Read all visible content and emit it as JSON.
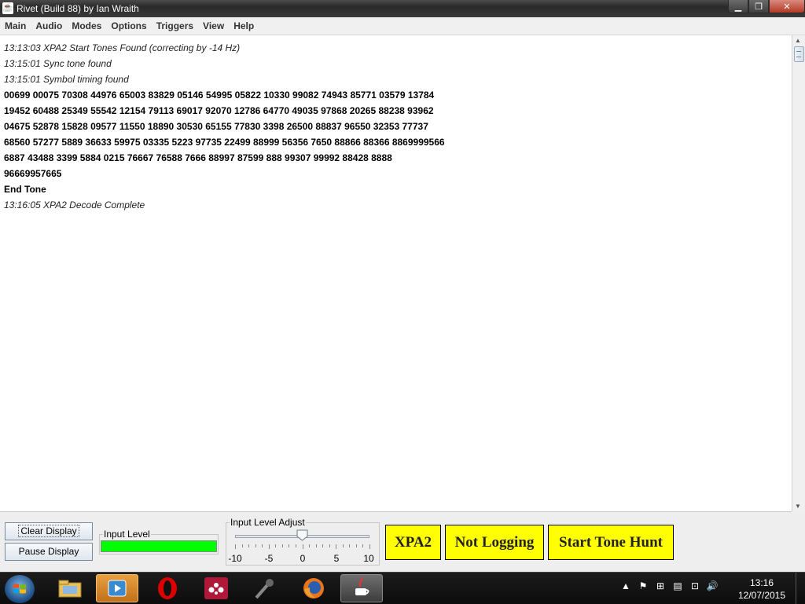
{
  "window": {
    "title": "Rivet (Build 88) by Ian Wraith",
    "icon": "java-cup-icon",
    "controls": [
      "minimize-icon",
      "maximize-icon",
      "close-icon"
    ]
  },
  "menu": {
    "items": [
      "Main",
      "Audio",
      "Modes",
      "Options",
      "Triggers",
      "View",
      "Help"
    ]
  },
  "log": {
    "lines": [
      {
        "text": "13:13:03 XPA2 Start Tones Found (correcting by -14 Hz)",
        "style": "italic"
      },
      {
        "text": "13:15:01 Sync tone found",
        "style": "italic"
      },
      {
        "text": "13:15:01 Symbol timing found",
        "style": "italic"
      },
      {
        "text": "00699 00075 70308 44976 65003 83829 05146 54995 05822 10330 99082 74943 85771 03579 13784",
        "style": "bold"
      },
      {
        "text": "19452 60488 25349 55542 12154 79113 69017 92070 12786 64770 49035 97868 20265 88238 93962",
        "style": "bold"
      },
      {
        "text": "04675 52878 15828 09577 11550 18890 30530 65155 77830 3398 26500 88837 96550 32353 77737",
        "style": "bold"
      },
      {
        "text": "68560 57277 5889 36633 59975 03335 5223 97735 22499 88999 56356 7650 88866 88366 8869999566",
        "style": "bold"
      },
      {
        "text": "6887 43488 3399 5884 0215 76667 76588 7666 88997 87599 888 99307 99992 88428 8888",
        "style": "bold"
      },
      {
        "text": "96669957665",
        "style": "bold"
      },
      {
        "text": "End Tone",
        "style": "bold"
      },
      {
        "text": "13:16:05 XPA2 Decode Complete",
        "style": "italic"
      }
    ]
  },
  "controls": {
    "clear_display": "Clear Display",
    "pause_display": "Pause Display",
    "input_level_label": "Input Level",
    "input_level_fraction": 1.0,
    "input_level_color": "#00ff00",
    "level_adjust_label": "Input Level Adjust",
    "level_adjust_min": -10,
    "level_adjust_max": 10,
    "level_adjust_value": 0,
    "level_adjust_ticks": [
      "-10",
      "-5",
      "0",
      "5",
      "10"
    ],
    "mode_button": "XPA2",
    "logging_button": "Not Logging",
    "tone_hunt_button": "Start Tone Hunt",
    "accent_button_color": "#ffff00"
  },
  "taskbar": {
    "apps": [
      "windows-explorer-icon",
      "media-player-icon",
      "opera-icon",
      "mendeley-icon",
      "microphone-icon",
      "firefox-icon",
      "java-icon"
    ],
    "active_app": "java-icon",
    "tray_icons": [
      "show-hidden-icons-chevron",
      "flag-icon",
      "windows-icon",
      "clipboard-icon",
      "network-icon",
      "volume-icon"
    ],
    "time": "13:16",
    "date": "12/07/2015"
  }
}
